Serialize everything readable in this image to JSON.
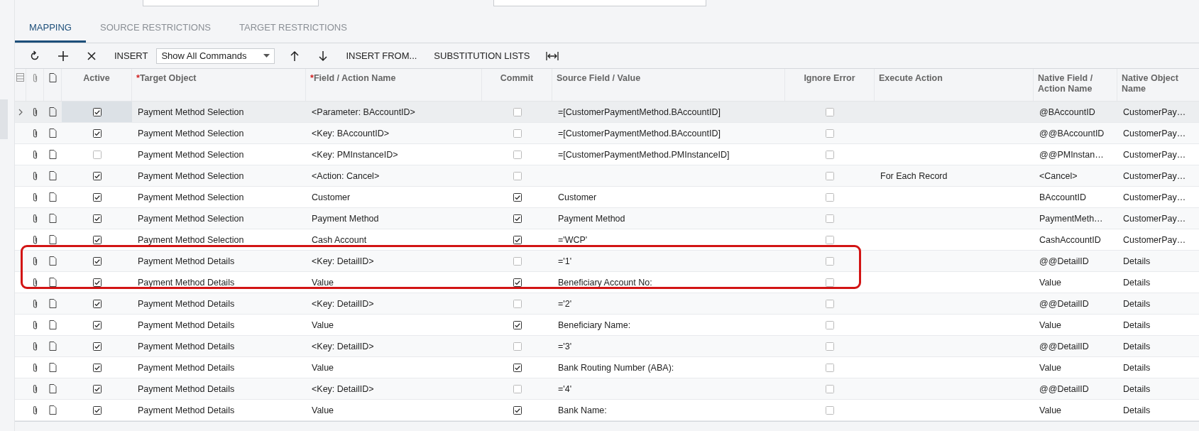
{
  "tabs": [
    {
      "label": "MAPPING",
      "selected": true
    },
    {
      "label": "SOURCE RESTRICTIONS",
      "selected": false
    },
    {
      "label": "TARGET RESTRICTIONS",
      "selected": false
    }
  ],
  "toolbar": {
    "insert": "INSERT",
    "commands": "Show All Commands",
    "insert_from": "INSERT FROM...",
    "substitution_lists": "SUBSTITUTION LISTS"
  },
  "columns": [
    {
      "label": "Active",
      "kind": "check"
    },
    {
      "label": "Target Object",
      "kind": "text",
      "required": "*"
    },
    {
      "label": "Field / Action Name",
      "kind": "text",
      "required": "*"
    },
    {
      "label": "Commit",
      "kind": "check"
    },
    {
      "label": "Source Field / Value",
      "kind": "text"
    },
    {
      "label": "Ignore Error",
      "kind": "check"
    },
    {
      "label": "Execute Action",
      "kind": "text"
    },
    {
      "label": "Native Field / Action Name",
      "kind": "text"
    },
    {
      "label": "Native Object Name",
      "kind": "text"
    }
  ],
  "rows": [
    {
      "selected": true,
      "circled": false,
      "active": true,
      "target": "Payment Method Selection",
      "field": "<Parameter: BAccountID>",
      "commit": false,
      "source": "=[CustomerPaymentMethod.BAccountID]",
      "ignore": false,
      "native_field": "@BAccountID",
      "native_object": "CustomerPay…"
    },
    {
      "selected": false,
      "circled": false,
      "active": true,
      "target": "Payment Method Selection",
      "field": "<Key: BAccountID>",
      "commit": false,
      "source": "=[CustomerPaymentMethod.BAccountID]",
      "ignore": false,
      "native_field": "@@BAccountID",
      "native_object": "CustomerPay…"
    },
    {
      "selected": false,
      "circled": false,
      "active": false,
      "target": "Payment Method Selection",
      "field": "<Key: PMInstanceID>",
      "commit": false,
      "source": "=[CustomerPaymentMethod.PMInstanceID]",
      "ignore": false,
      "native_field": "@@PMInstan…",
      "native_object": "CustomerPay…"
    },
    {
      "selected": false,
      "circled": false,
      "active": true,
      "target": "Payment Method Selection",
      "field": "<Action: Cancel>",
      "commit": false,
      "ignore": false,
      "action": "For Each Record",
      "native_field": "<Cancel>",
      "native_object": "CustomerPay…"
    },
    {
      "selected": false,
      "circled": false,
      "active": true,
      "target": "Payment Method Selection",
      "field": "Customer",
      "commit": true,
      "source": "Customer",
      "ignore": false,
      "native_field": "BAccountID",
      "native_object": "CustomerPay…"
    },
    {
      "selected": false,
      "circled": false,
      "active": true,
      "target": "Payment Method Selection",
      "field": "Payment Method",
      "commit": true,
      "source": "Payment Method",
      "ignore": false,
      "native_field": "PaymentMeth…",
      "native_object": "CustomerPay…"
    },
    {
      "selected": false,
      "circled": false,
      "active": true,
      "target": "Payment Method Selection",
      "field": "Cash Account",
      "commit": true,
      "source": "='WCP'",
      "ignore": false,
      "native_field": "CashAccountID",
      "native_object": "CustomerPay…"
    },
    {
      "selected": false,
      "circled": true,
      "active": true,
      "target": "Payment Method Details",
      "field": "<Key: DetailID>",
      "commit": false,
      "source": "='1'",
      "ignore": false,
      "native_field": "@@DetailID",
      "native_object": "Details"
    },
    {
      "selected": false,
      "circled": true,
      "active": true,
      "target": "Payment Method Details",
      "field": "Value",
      "commit": true,
      "source": "Beneficiary Account No:",
      "ignore": false,
      "native_field": "Value",
      "native_object": "Details"
    },
    {
      "selected": false,
      "circled": false,
      "active": true,
      "target": "Payment Method Details",
      "field": "<Key: DetailID>",
      "commit": false,
      "source": "='2'",
      "ignore": false,
      "native_field": "@@DetailID",
      "native_object": "Details"
    },
    {
      "selected": false,
      "circled": false,
      "active": true,
      "target": "Payment Method Details",
      "field": "Value",
      "commit": true,
      "source": "Beneficiary Name:",
      "ignore": false,
      "native_field": "Value",
      "native_object": "Details"
    },
    {
      "selected": false,
      "circled": false,
      "active": true,
      "target": "Payment Method Details",
      "field": "<Key: DetailID>",
      "commit": false,
      "source": "='3'",
      "ignore": false,
      "native_field": "@@DetailID",
      "native_object": "Details"
    },
    {
      "selected": false,
      "circled": false,
      "active": true,
      "target": "Payment Method Details",
      "field": "Value",
      "commit": true,
      "source": "Bank Routing Number (ABA):",
      "ignore": false,
      "native_field": "Value",
      "native_object": "Details"
    },
    {
      "selected": false,
      "circled": false,
      "active": true,
      "target": "Payment Method Details",
      "field": "<Key: DetailID>",
      "commit": false,
      "source": "='4'",
      "ignore": false,
      "native_field": "@@DetailID",
      "native_object": "Details"
    },
    {
      "selected": false,
      "circled": false,
      "active": true,
      "target": "Payment Method Details",
      "field": "Value",
      "commit": true,
      "source": "Bank Name:",
      "ignore": false,
      "native_field": "Value",
      "native_object": "Details"
    }
  ]
}
